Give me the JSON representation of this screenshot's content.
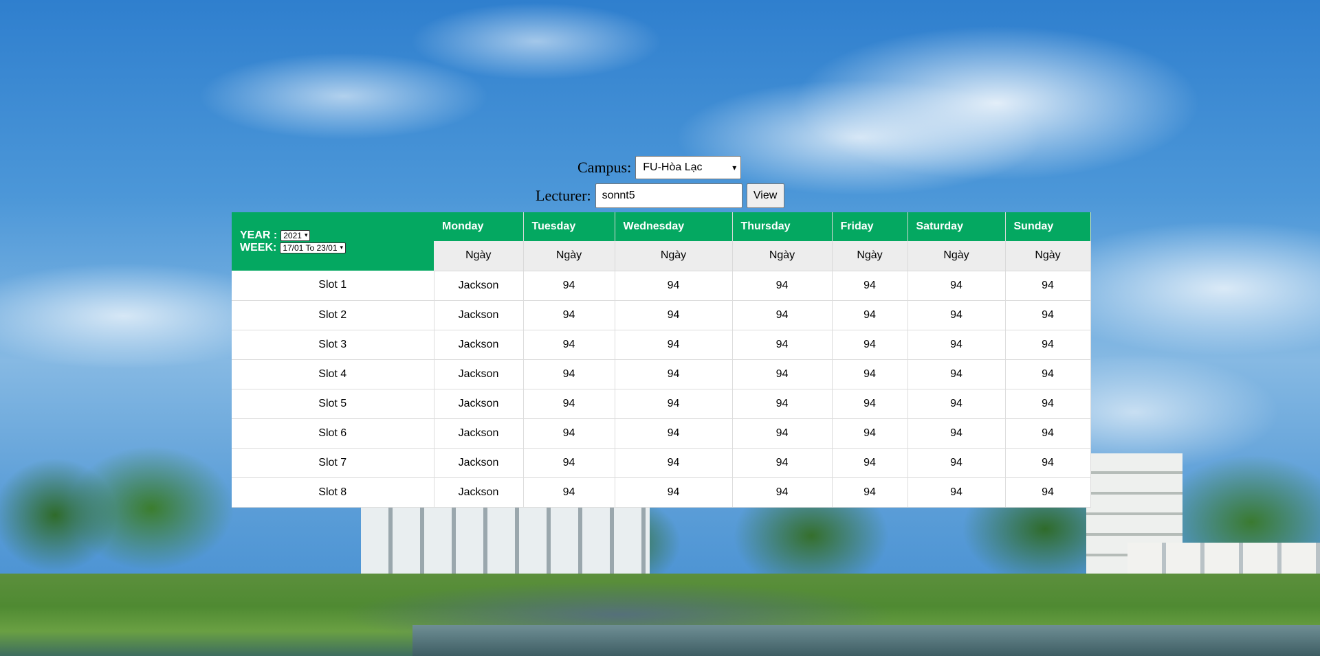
{
  "filters": {
    "campus_label": "Campus:",
    "campus_value": "FU-Hòa Lạc",
    "lecturer_label": "Lecturer:",
    "lecturer_value": "sonnt5",
    "view_button": "View"
  },
  "timetable": {
    "year_label": "YEAR :",
    "year_value": "2021",
    "week_label": "WEEK:",
    "week_value": "17/01 To 23/01",
    "days": [
      {
        "name": "Monday",
        "sub": "Ngày"
      },
      {
        "name": "Tuesday",
        "sub": "Ngày"
      },
      {
        "name": "Wednesday",
        "sub": "Ngày"
      },
      {
        "name": "Thursday",
        "sub": "Ngày"
      },
      {
        "name": "Friday",
        "sub": "Ngày"
      },
      {
        "name": "Saturday",
        "sub": "Ngày"
      },
      {
        "name": "Sunday",
        "sub": "Ngày"
      }
    ],
    "rows": [
      {
        "slot": "Slot 1",
        "cells": [
          "Jackson",
          "94",
          "94",
          "94",
          "94",
          "94",
          "94"
        ]
      },
      {
        "slot": "Slot 2",
        "cells": [
          "Jackson",
          "94",
          "94",
          "94",
          "94",
          "94",
          "94"
        ]
      },
      {
        "slot": "Slot 3",
        "cells": [
          "Jackson",
          "94",
          "94",
          "94",
          "94",
          "94",
          "94"
        ]
      },
      {
        "slot": "Slot 4",
        "cells": [
          "Jackson",
          "94",
          "94",
          "94",
          "94",
          "94",
          "94"
        ]
      },
      {
        "slot": "Slot 5",
        "cells": [
          "Jackson",
          "94",
          "94",
          "94",
          "94",
          "94",
          "94"
        ]
      },
      {
        "slot": "Slot 6",
        "cells": [
          "Jackson",
          "94",
          "94",
          "94",
          "94",
          "94",
          "94"
        ]
      },
      {
        "slot": "Slot 7",
        "cells": [
          "Jackson",
          "94",
          "94",
          "94",
          "94",
          "94",
          "94"
        ]
      },
      {
        "slot": "Slot 8",
        "cells": [
          "Jackson",
          "94",
          "94",
          "94",
          "94",
          "94",
          "94"
        ]
      }
    ]
  },
  "colors": {
    "header_green": "#04a861",
    "subheader_gray": "#ededed"
  }
}
